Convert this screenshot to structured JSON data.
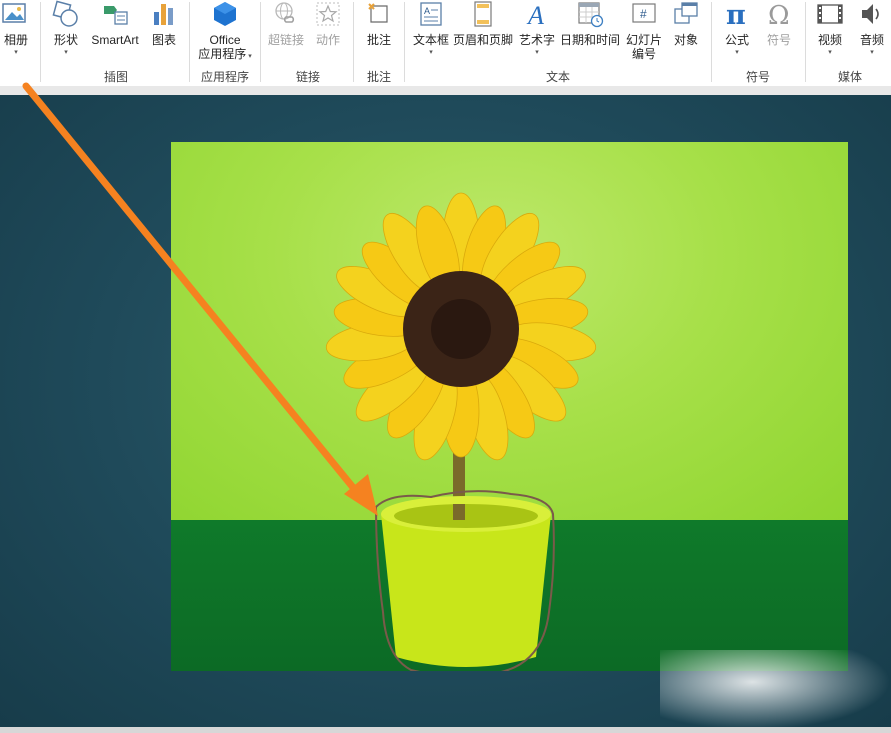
{
  "ribbon": {
    "buttons": {
      "album": "相册",
      "shapes": "形状",
      "smartart": "SmartArt",
      "chart": "图表",
      "office_line1": "Office",
      "office_line2": "应用程序",
      "hyperlink": "超链接",
      "action": "动作",
      "comment": "批注",
      "textbox": "文本框",
      "header_footer": "页眉和页脚",
      "wordart": "艺术字",
      "datetime": "日期和时间",
      "slide_number_line1": "幻灯片",
      "slide_number_line2": "编号",
      "object": "对象",
      "equation": "公式",
      "symbol": "符号",
      "video": "视频",
      "audio": "音频"
    },
    "groups": {
      "illustrations": "插图",
      "apps": "应用程序",
      "links": "链接",
      "comments": "批注",
      "text": "文本",
      "symbols": "符号",
      "media": "媒体"
    },
    "icons": {
      "equation_glyph": "π",
      "symbol_glyph": "Ω",
      "wordart_glyph": "A",
      "slide_number_glyph": "#"
    },
    "dropdown_arrow": "▾"
  },
  "colors": {
    "annotation_arrow": "#f58220",
    "selection_outline": "#7a5a4a",
    "workspace_bg": "#1f4a5a",
    "wall": "#a7e049",
    "table": "#0f7a2a",
    "pot": "#c8e61a",
    "petal": "#f6c915",
    "flower_center": "#3b2417"
  }
}
